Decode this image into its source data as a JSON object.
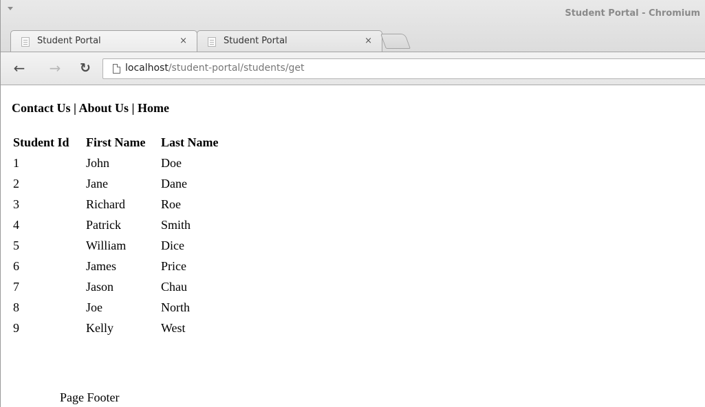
{
  "window": {
    "title": "Student Portal - Chromium"
  },
  "tabs": [
    {
      "label": "Student Portal",
      "close": "×"
    },
    {
      "label": "Student Portal",
      "close": "×"
    }
  ],
  "toolbar": {
    "back": "←",
    "forward": "→",
    "reload": "↻"
  },
  "address": {
    "host": "localhost",
    "path": "/student-portal/students/get"
  },
  "nav": {
    "contact": "Contact Us",
    "sep1": " | ",
    "about": "About Us",
    "sep2": " | ",
    "home": "Home"
  },
  "table": {
    "headers": [
      "Student Id",
      "First Name",
      "Last Name"
    ],
    "rows": [
      [
        "1",
        "John",
        "Doe"
      ],
      [
        "2",
        "Jane",
        "Dane"
      ],
      [
        "3",
        "Richard",
        "Roe"
      ],
      [
        "4",
        "Patrick",
        "Smith"
      ],
      [
        "5",
        "William",
        "Dice"
      ],
      [
        "6",
        "James",
        "Price"
      ],
      [
        "7",
        "Jason",
        "Chau"
      ],
      [
        "8",
        "Joe",
        "North"
      ],
      [
        "9",
        "Kelly",
        "West"
      ]
    ]
  },
  "footer": {
    "text": "Page Footer"
  }
}
